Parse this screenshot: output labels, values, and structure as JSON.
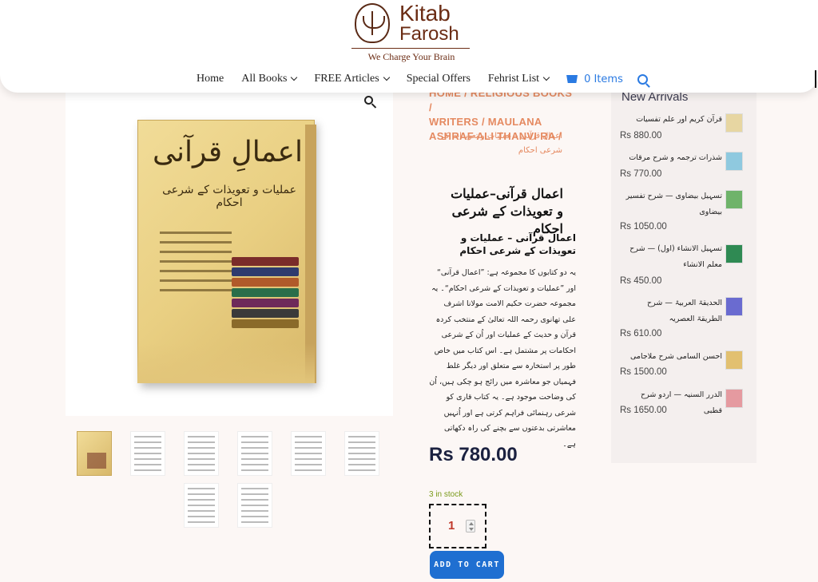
{
  "logo": {
    "line1": "Kitab",
    "line2": "Farosh",
    "tagline": "We Charge Your Brain"
  },
  "nav": {
    "items": [
      {
        "label": "Home",
        "dropdown": false
      },
      {
        "label": "All Books",
        "dropdown": true
      },
      {
        "label": "FREE Articles",
        "dropdown": true
      },
      {
        "label": "Special Offers",
        "dropdown": false
      },
      {
        "label": "Fehrist List",
        "dropdown": true
      }
    ],
    "cart_label": "0 Items"
  },
  "colors": {
    "accent": "#2a7ae2",
    "breadcrumb": "#e58a61",
    "price": "#1b2140",
    "button": "#1f6fd1",
    "stock": "#7a9a1a"
  },
  "product": {
    "cover_title": "اعمالِ قرآنی",
    "cover_sub": "عملیات و تعویذات کے شرعی احکام",
    "breadcrumb_lines": [
      "HOME / RELIGIOUS BOOKS /",
      "WRITERS / MAULANA",
      "ASHRAF ALI THANVI RA /"
    ],
    "breadcrumb_urdu": "اعمال قرآنی – عملیات و تعویذات کے شرعی احکام",
    "title": "اعمال قرآنی–عملیات و تعویذات کے شرعی احکام",
    "subtitle": "اعمال قرآنی – عملیات و تعویذات کے شرعی احکام",
    "description": "یہ دو کتابوں کا مجموعہ ہے: ”اعمال قرآنی“ اور ”عملیات و تعویذات کے شرعی احکام“۔ یہ مجموعہ حضرت حکیم الامت مولانا اشرف علی تھانوی رحمہ اللہ تعالیٰ کے منتخب کردہ قرآن و حدیث کے عملیات اور اُن کے شرعی احکامات پر مشتمل ہے۔ اس کتاب میں خاص طور پر استخارہ سے متعلق اور دیگر غلط فہمیاں جو معاشرہ میں رائج ہو چکی ہیں، اُن کی وضاحت موجود ہے۔ یہ کتاب قاری کو شرعی رہنمائی فراہم کرتی ہے اور اُنہیں معاشرتی بدعتوں سے بچنے کی راہ دکھاتی ہے۔",
    "price": "Rs 780.00",
    "stock": "3 in stock",
    "quantity": "1",
    "add_to_cart": "ADD TO CART"
  },
  "sidebar": {
    "title": "New Arrivals",
    "items": [
      {
        "name": "قرآن کریم اور علم تفسیات",
        "price": "Rs 880.00",
        "thumb_color": "#e7d6a2"
      },
      {
        "name": "شذرات ترجمہ و شرح مرقات",
        "price": "Rs 770.00",
        "thumb_color": "#8fc9df"
      },
      {
        "name": "تسہیل بیضاوی — شرح تفسیر بیضاوی",
        "price": "Rs 1050.00",
        "thumb_color": "#6fb36a"
      },
      {
        "name": "تسہیل الانشاء (اول) — شرح معلم الانشاء",
        "price": "Rs 450.00",
        "thumb_color": "#2f8a53"
      },
      {
        "name": "الحدیقۃ العربیۃ — شرح الطریقۃ العصریہ",
        "price": "Rs 610.00",
        "thumb_color": "#6a6bd0"
      },
      {
        "name": "احسن السامی شرح ملاجامی",
        "price": "Rs 1500.00",
        "thumb_color": "#e2c070"
      },
      {
        "name": "الدرر السنیہ — اردو شرح قطبی",
        "price": "Rs 1650.00",
        "thumb_color": "#e59aa0"
      }
    ]
  }
}
